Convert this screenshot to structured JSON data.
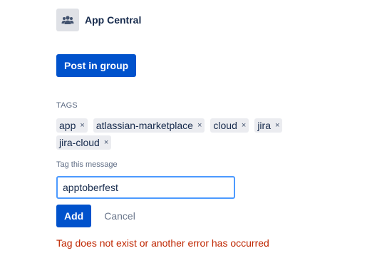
{
  "group": {
    "name": "App Central",
    "icon": "people-group-icon"
  },
  "post_button_label": "Post in group",
  "tags_section": {
    "heading": "TAGS",
    "tags": [
      {
        "label": "app",
        "remove": "×"
      },
      {
        "label": "atlassian-marketplace",
        "remove": "×"
      },
      {
        "label": "cloud",
        "remove": "×"
      },
      {
        "label": "jira",
        "remove": "×"
      },
      {
        "label": "jira-cloud",
        "remove": "×"
      }
    ]
  },
  "tag_form": {
    "label": "Tag this message",
    "input_value": "apptoberfest",
    "add_label": "Add",
    "cancel_label": "Cancel"
  },
  "error": {
    "message": "Tag does not exist or another error has occurred",
    "color": "#bf2600"
  },
  "colors": {
    "primary": "#0052cc",
    "focus_border": "#4c9aff",
    "tag_bg": "#ebecf0"
  }
}
